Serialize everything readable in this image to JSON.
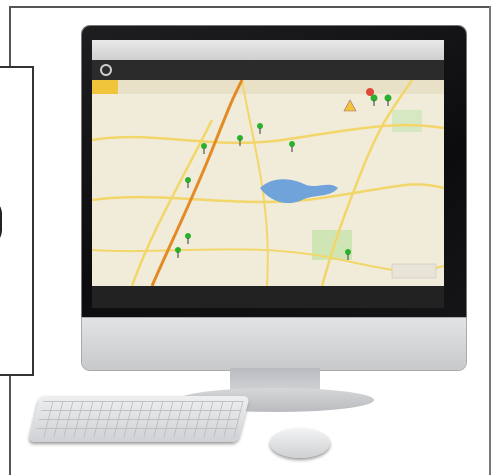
{
  "browser": {
    "title": "",
    "url": ""
  },
  "app": {
    "nav_items": [],
    "status_text": ""
  },
  "colors": {
    "bezel": "#0c0c0e",
    "map_background": "#f1ecd9",
    "roads": "#f2d66a",
    "highway": "#e48a24",
    "water": "#6fa3d9",
    "marker": "#2bb02b"
  },
  "icons": {
    "map_marker": "map-pin-icon",
    "alert": "warning-icon"
  }
}
